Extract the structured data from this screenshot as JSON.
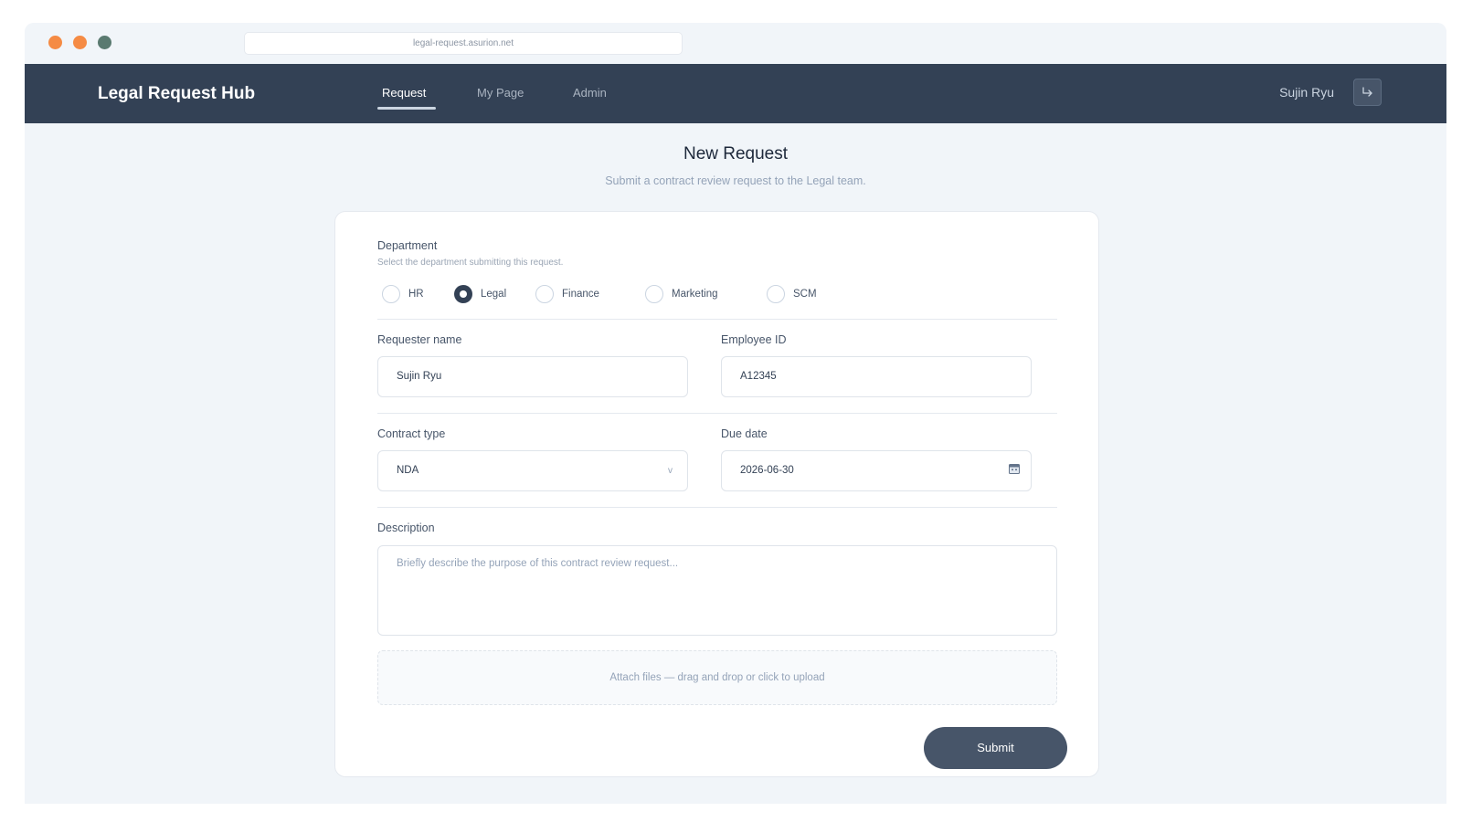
{
  "window": {
    "dots": [
      {
        "name": "close",
        "color": "#f58b44"
      },
      {
        "name": "minimize",
        "color": "#f58b44"
      },
      {
        "name": "maximize",
        "color": "#5a7a70"
      }
    ],
    "url": "legal-request.asurion.net"
  },
  "header": {
    "brand": "Legal Request Hub",
    "tabs": [
      {
        "label": "Request",
        "active": true
      },
      {
        "label": "My Page",
        "active": false
      },
      {
        "label": "Admin",
        "active": false
      }
    ],
    "user_name": "Sujin Ryu",
    "logout_icon": "logout-icon"
  },
  "page": {
    "title": "New Request",
    "subtitle": "Submit a contract review request to the Legal team."
  },
  "form": {
    "department": {
      "label": "Department",
      "help": "Select the department submitting this request.",
      "options": [
        "HR",
        "Legal",
        "Finance",
        "Marketing",
        "SCM"
      ],
      "selected": "Legal"
    },
    "requester_name": {
      "label": "Requester name",
      "value": "Sujin Ryu"
    },
    "employee_id": {
      "label": "Employee ID",
      "value": "A12345"
    },
    "contract_type": {
      "label": "Contract type",
      "value": "NDA",
      "chevron": "v"
    },
    "due_date": {
      "label": "Due date",
      "value": "2026-06-30",
      "icon": "calendar-icon"
    },
    "description": {
      "label": "Description",
      "placeholder": "Briefly describe the purpose of this contract review request..."
    },
    "attach_text": "Attach files — drag and drop or click to upload",
    "submit_label": "Submit"
  },
  "colors": {
    "navbar": "#334155",
    "page_bg": "#f1f5f9",
    "accent": "#475569"
  }
}
